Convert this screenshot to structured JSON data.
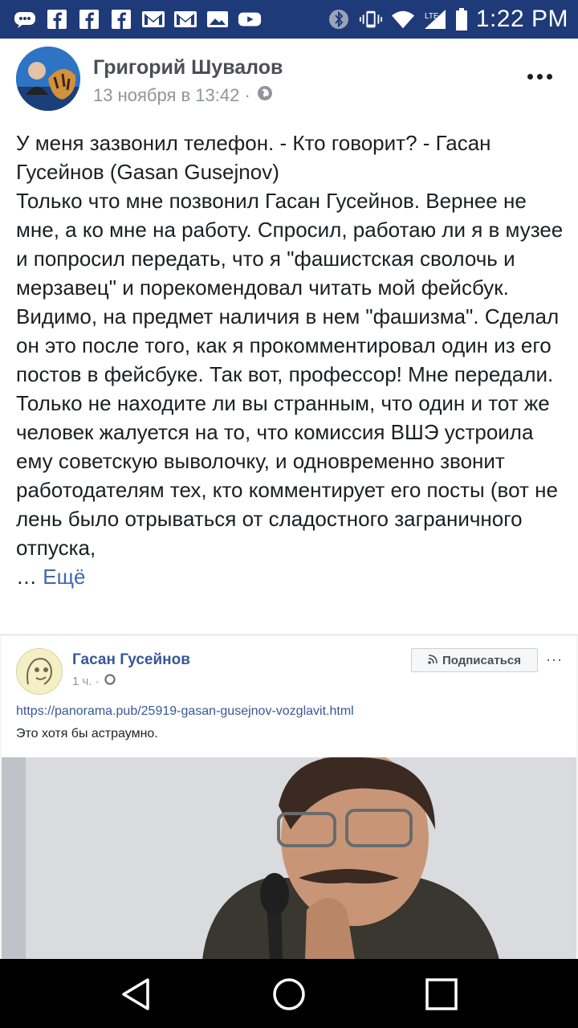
{
  "status_bar": {
    "time": "1:22 PM",
    "icons": [
      "messenger-icon",
      "facebook-icon",
      "facebook-icon",
      "facebook-icon",
      "gmail-icon",
      "gmail-icon",
      "gallery-icon",
      "youtube-icon",
      "bluetooth-icon",
      "vibrate-icon",
      "wifi-icon",
      "signal-icon",
      "battery-icon"
    ]
  },
  "post": {
    "author": "Григорий Шувалов",
    "date": "13 ноября в 13:42 ·",
    "privacy_icon": "globe-icon",
    "more_icon": "more-dots-icon",
    "text_paragraphs": [
      "У меня зазвонил телефон. - Кто говорит? - Гасан Гусейнов (Gasan Gusejnov)",
      "Только что мне позвонил Гасан Гусейнов. Вернее не мне, а ко мне на работу. Спросил, работаю ли я в музее и попросил передать, что я \"фашистская сволочь и мерзавец\" и порекомендовал читать мой фейсбук. Видимо, на предмет наличия в нем \"фашизма\". Сделал он это после того, как я прокомментировал один из его постов в фейсбуке. Так вот, профессор! Мне передали.",
      "Только не находите ли вы странным, что один и тот же человек жалуется на то, что комиссия ВШЭ устроила ему советскую выволочку, и одновременно звонит работодателям тех, кто комментирует его посты (вот не лень было отрываться от сладостного заграничного отпуска,"
    ],
    "truncation": "…",
    "more_label": "Ещё"
  },
  "embed": {
    "author": "Гасан Гусейнов",
    "time": "1 ч. ·",
    "subscribe_label": "Подписаться",
    "more_label": "···",
    "link": "https://panorama.pub/25919-gasan-gusejnov-vozglavit.html",
    "text": "Это хотя бы астраумно."
  },
  "colors": {
    "status_bar": "#1f3a78",
    "link": "#4267b2",
    "nav_bar": "#000000"
  }
}
